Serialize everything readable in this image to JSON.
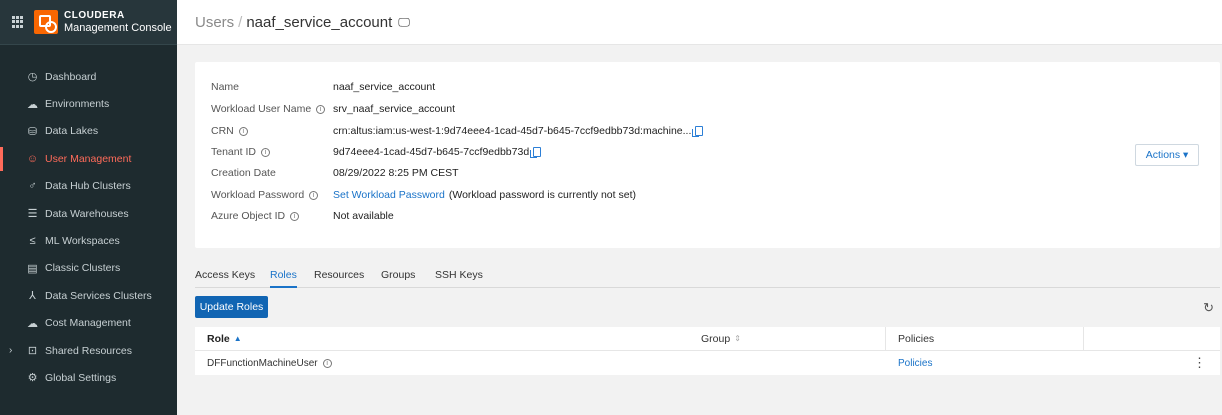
{
  "brand": {
    "name": "CLOUDERA",
    "subtitle": "Management Console"
  },
  "sidebar": {
    "items": [
      {
        "label": "Dashboard",
        "icon": "◷"
      },
      {
        "label": "Environments",
        "icon": "☁"
      },
      {
        "label": "Data Lakes",
        "icon": "⛁"
      },
      {
        "label": "User Management",
        "icon": "☺"
      },
      {
        "label": "Data Hub Clusters",
        "icon": "♂"
      },
      {
        "label": "Data Warehouses",
        "icon": "☰"
      },
      {
        "label": "ML Workspaces",
        "icon": "≤"
      },
      {
        "label": "Classic Clusters",
        "icon": "▤"
      },
      {
        "label": "Data Services Clusters",
        "icon": "⅄"
      },
      {
        "label": "Cost Management",
        "icon": "☁"
      },
      {
        "label": "Shared Resources",
        "icon": "⊡"
      },
      {
        "label": "Global Settings",
        "icon": "⚙"
      }
    ],
    "active_index": 3,
    "expand_caret": "›"
  },
  "header": {
    "breadcrumb_parent": "Users",
    "separator": "/",
    "title": "naaf_service_account",
    "monitor_icon": "🖵"
  },
  "details": {
    "name_label": "Name",
    "name_value": "naaf_service_account",
    "workload_label": "Workload User Name",
    "workload_value": "srv_naaf_service_account",
    "crn_label": "CRN",
    "crn_value": "crn:altus:iam:us-west-1:9d74eee4-1cad-45d7-b645-7ccf9edbb73d:machine...",
    "tenant_label": "Tenant ID",
    "tenant_value": "9d74eee4-1cad-45d7-b645-7ccf9edbb73d",
    "created_label": "Creation Date",
    "created_value": "08/29/2022 8:25 PM CEST",
    "password_label": "Workload Password",
    "password_link": "Set Workload Password",
    "password_note": "(Workload password is currently not set)",
    "azure_label": "Azure Object ID",
    "azure_value": "Not available",
    "actions_label": "Actions ▾",
    "info_glyph": "i"
  },
  "tabs": [
    "Access Keys",
    "Roles",
    "Resources",
    "Groups",
    "SSH Keys"
  ],
  "active_tab": 1,
  "update_roles_label": "Update Roles",
  "refresh_icon": "↻",
  "table": {
    "headers": {
      "role": "Role",
      "group": "Group",
      "policies": "Policies"
    },
    "sort_up": "▲",
    "sort_both": "⇕",
    "rows": [
      {
        "role": "DFFunctionMachineUser",
        "group": "",
        "policies": "Policies"
      }
    ],
    "kebab": "⋮"
  },
  "colors": {
    "sidebar_bg": "#1e2b2f",
    "accent": "#1a73c8",
    "active_nav": "#ff6b5a",
    "brand_orange": "#f96702"
  }
}
